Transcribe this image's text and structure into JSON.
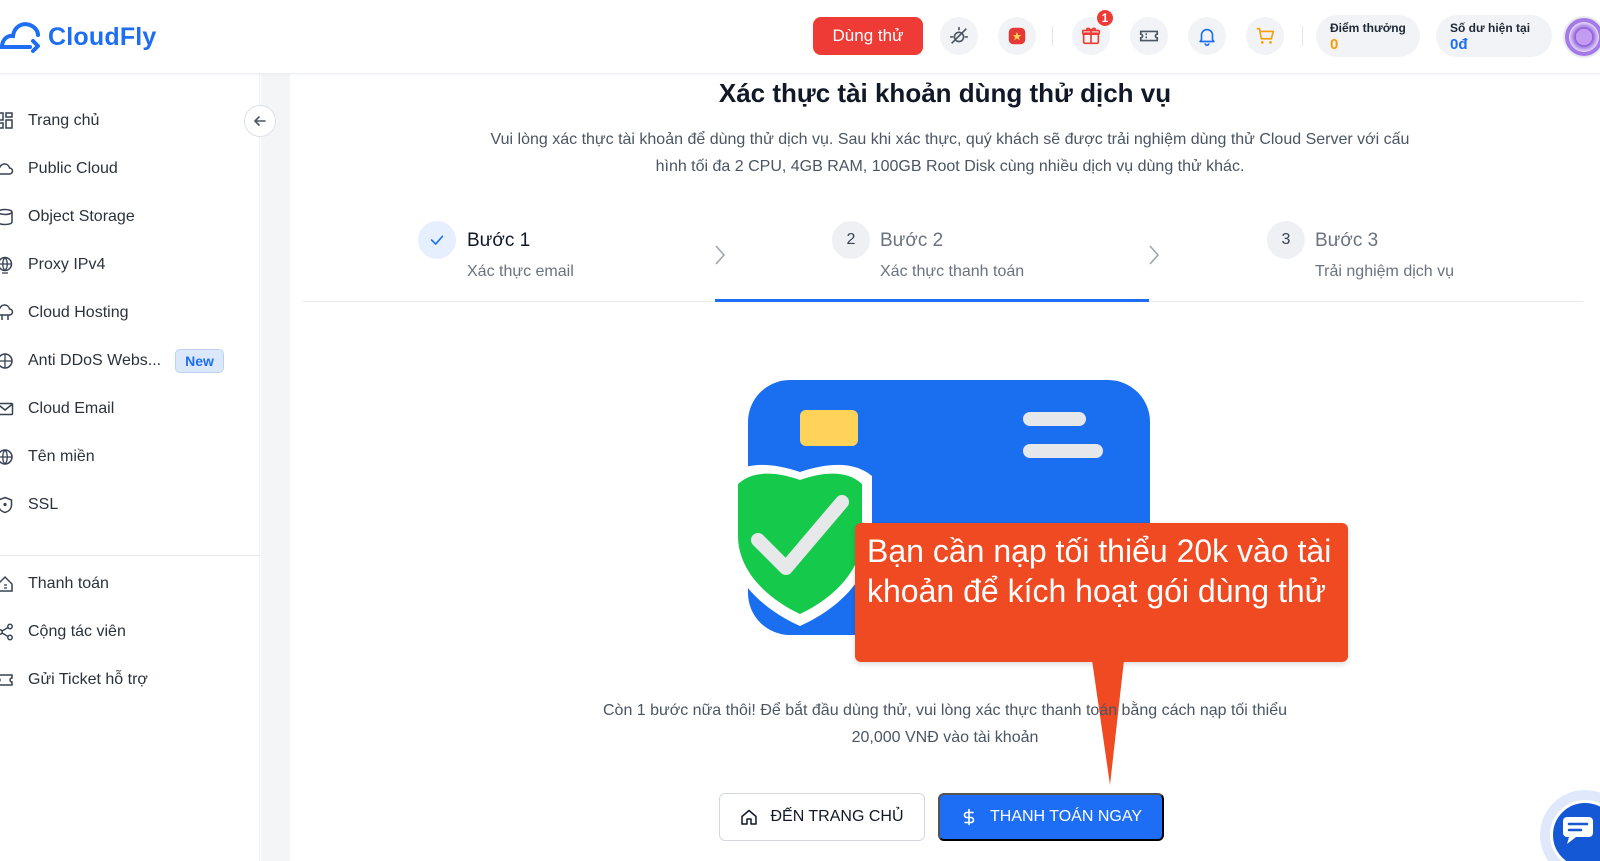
{
  "header": {
    "logo_text": "CloudFly",
    "trial_button": "Dùng thử",
    "gift_badge": "1",
    "reward_points": {
      "label": "Điểm thưởng",
      "value": "0"
    },
    "balance": {
      "label": "Số dư hiện tại",
      "value": "0đ"
    },
    "icons": [
      "theme-toggle-icon",
      "vietnam-flag-icon",
      "gift-icon",
      "ticket-icon",
      "bell-icon",
      "cart-icon"
    ]
  },
  "sidebar": {
    "items": [
      {
        "label": "Trang chủ",
        "icon": "dashboard-icon"
      },
      {
        "label": "Public Cloud",
        "icon": "cloud-icon"
      },
      {
        "label": "Object Storage",
        "icon": "storage-icon"
      },
      {
        "label": "Proxy IPv4",
        "icon": "globe-icon"
      },
      {
        "label": "Cloud Hosting",
        "icon": "hosting-icon"
      },
      {
        "label": "Anti DDoS Webs...",
        "icon": "shield-globe-icon",
        "badge": "New"
      },
      {
        "label": "Cloud Email",
        "icon": "mail-icon"
      },
      {
        "label": "Tên miền",
        "icon": "domain-icon"
      },
      {
        "label": "SSL",
        "icon": "shield-icon"
      }
    ],
    "items2": [
      {
        "label": "Thanh toán",
        "icon": "billing-icon"
      },
      {
        "label": "Cộng tác viên",
        "icon": "share-icon"
      },
      {
        "label": "Gửi Ticket hỗ trợ",
        "icon": "ticket-icon"
      }
    ]
  },
  "main": {
    "title": "Xác thực tài khoản dùng thử dịch vụ",
    "subtitle": "Vui lòng xác thực tài khoản để dùng thử dịch vụ. Sau khi xác thực, quý khách sẽ được trải nghiệm dùng thử Cloud Server với cấu hình tối đa 2 CPU, 4GB RAM, 100GB Root Disk cùng nhiều dịch vụ dùng thử khác.",
    "steps": [
      {
        "number": "",
        "title": "Bước 1",
        "desc": "Xác thực email",
        "status": "done"
      },
      {
        "number": "2",
        "title": "Bước 2",
        "desc": "Xác thực thanh toán",
        "status": "active"
      },
      {
        "number": "3",
        "title": "Bước 3",
        "desc": "Trải nghiệm dịch vụ",
        "status": "pending"
      }
    ],
    "tooltip": "Bạn cần nạp tối thiểu 20k vào tài khoản để kích hoạt gói dùng thử",
    "hint": "Còn 1 bước nữa thôi! Để bắt đầu dùng thử, vui lòng xác thực thanh toán bằng cách nạp tối thiểu 20,000 VNĐ vào tài khoản",
    "buttons": {
      "home": "ĐẾN TRANG CHỦ",
      "pay": "THANH TOÁN NGAY"
    }
  },
  "colors": {
    "accent": "#1d6ef5",
    "danger": "#ef3b36",
    "tooltip": "#f04a23",
    "points": "#f59e0b",
    "balance": "#1d6ef5"
  }
}
